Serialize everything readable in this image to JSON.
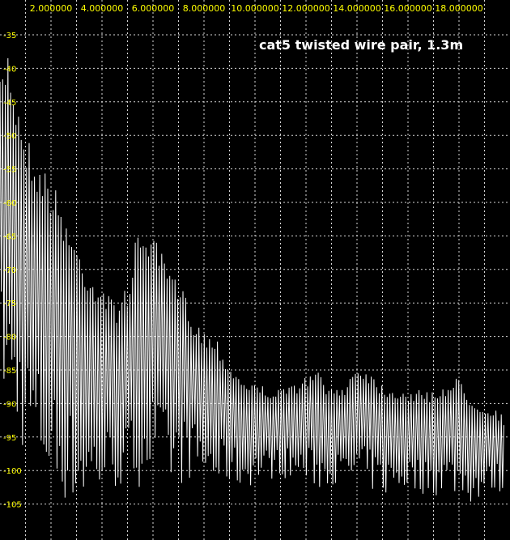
{
  "chart_data": {
    "type": "line",
    "title": "cat5 twisted wire pair, 1.3m",
    "xlabel": "",
    "ylabel": "",
    "x_ticks": [
      "2.000000",
      "4.000000",
      "6.000000",
      "8.000000",
      "10.000000",
      "12.000000",
      "14.000000",
      "16.000000",
      "18.000000"
    ],
    "y_ticks": [
      "-35",
      "-40",
      "-45",
      "-50",
      "-55",
      "-60",
      "-65",
      "-70",
      "-75",
      "-80",
      "-85",
      "-90",
      "-95",
      "-100",
      "-105"
    ],
    "xlim": [
      0,
      19.8
    ],
    "ylim": [
      -107.5,
      -33
    ],
    "grid": true,
    "colors": {
      "background": "#000000",
      "trace": "#ffffff",
      "tick_labels": "#ffff00",
      "grid": "#d8d8d8"
    },
    "envelope": {
      "x": [
        0,
        0.3,
        0.6,
        1.0,
        1.4,
        1.8,
        2.2,
        2.6,
        3.0,
        3.5,
        4.0,
        4.5,
        5.0,
        5.3,
        5.6,
        6.0,
        6.4,
        6.8,
        7.2,
        7.6,
        8.0,
        8.5,
        9.0,
        9.5,
        10.0,
        11.0,
        12.0,
        12.5,
        13.0,
        13.5,
        14.0,
        14.5,
        15.0,
        16.0,
        17.0,
        17.5,
        18.0,
        18.5,
        19.0,
        19.5,
        19.8
      ],
      "max": [
        -42,
        -36,
        -43,
        -49,
        -53,
        -55,
        -58,
        -62,
        -66,
        -70,
        -72,
        -75,
        -72,
        -66,
        -63,
        -65,
        -68,
        -71,
        -73,
        -77,
        -79,
        -80,
        -84,
        -86,
        -87,
        -88,
        -86,
        -85,
        -88,
        -87,
        -84,
        -85,
        -87,
        -88,
        -88,
        -87,
        -86,
        -89,
        -90,
        -91,
        -92
      ],
      "min": [
        -88,
        -92,
        -95,
        -98,
        -100,
        -102,
        -104,
        -105,
        -106,
        -105,
        -104,
        -103,
        -104,
        -103,
        -102,
        -101,
        -102,
        -103,
        -102,
        -101,
        -102,
        -103,
        -102,
        -103,
        -102,
        -101,
        -102,
        -103,
        -102,
        -103,
        -102,
        -103,
        -104,
        -103,
        -104,
        -103,
        -104,
        -105,
        -104,
        -103,
        -104
      ]
    }
  }
}
